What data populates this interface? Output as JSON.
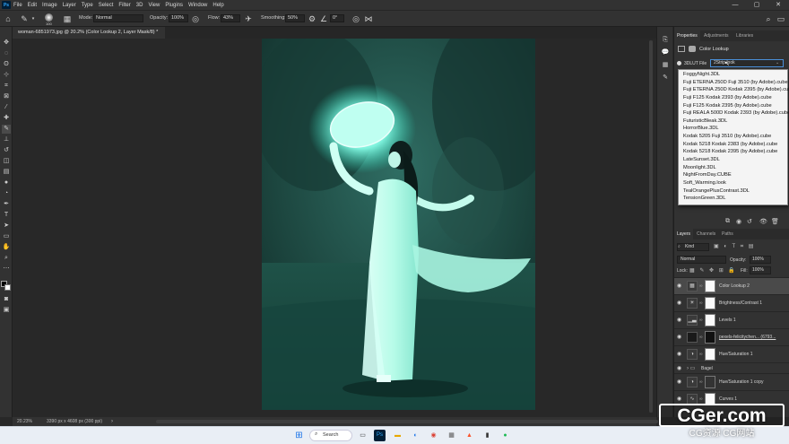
{
  "menubar": {
    "app_icon": "Ps",
    "items": [
      "File",
      "Edit",
      "Image",
      "Layer",
      "Type",
      "Select",
      "Filter",
      "3D",
      "View",
      "Plugins",
      "Window",
      "Help"
    ],
    "window_controls": [
      "—",
      "▢",
      "✕"
    ]
  },
  "options_bar": {
    "brush_size": "100",
    "mode_label": "Mode:",
    "mode_value": "Normal",
    "opacity_label": "Opacity:",
    "opacity_value": "100%",
    "flow_label": "Flow:",
    "flow_value": "43%",
    "smoothing_label": "Smoothing:",
    "smoothing_value": "50%",
    "angle_value": "0°"
  },
  "document": {
    "tab_title": "woman-6851973.jpg @ 20.2% (Color Lookup 2, Layer Mask/8) *",
    "zoom": "20.23%",
    "dimensions": "3390 px x 4608 px (300 ppi)"
  },
  "properties": {
    "tabs": [
      "Properties",
      "Adjustments",
      "Libraries"
    ],
    "panel_title": "Color Lookup",
    "row_label": "3DLUT File",
    "row_value": "2Strip.look"
  },
  "lut_options": [
    "FoggyNight.3DL",
    "Fuji ETERNA 250D Fuji 3510 (by Adobe).cube",
    "Fuji ETERNA 250D Kodak 2395 (by Adobe).cube",
    "Fuji F125 Kodak 2393 (by Adobe).cube",
    "Fuji F125 Kodak 2395 (by Adobe).cube",
    "Fuji REALA 500D Kodak 2393 (by Adobe).cube",
    "FuturisticBleak.3DL",
    "HorrorBlue.3DL",
    "Kodak 5205 Fuji 3510 (by Adobe).cube",
    "Kodak 5218 Kodak 2383 (by Adobe).cube",
    "Kodak 5218 Kodak 2395 (by Adobe).cube",
    "LateSunset.3DL",
    "Moonlight.3DL",
    "NightFromDay.CUBE",
    "Soft_Warming.look",
    "TealOrangePlusContrast.3DL",
    "TensionGreen.3DL"
  ],
  "layers_panel": {
    "tabs": [
      "Layers",
      "Channels",
      "Paths"
    ],
    "filter_kind": "Kind",
    "blend_mode": "Normal",
    "opacity_label": "Opacity:",
    "opacity_value": "100%",
    "lock_label": "Lock:",
    "fill_label": "Fill:",
    "fill_value": "100%",
    "layers": [
      {
        "name": "Color Lookup 2",
        "icon": "grid-icon"
      },
      {
        "name": "Brightness/Contrast 1",
        "icon": "sun-icon"
      },
      {
        "name": "Levels 1",
        "icon": "histogram-icon"
      },
      {
        "name": "pexels-felicitychen... (6793...",
        "icon": "photo-icon"
      },
      {
        "name": "Hue/Saturation 1",
        "icon": "hue-icon"
      },
      {
        "name": "Bagel",
        "icon": "folder-icon"
      },
      {
        "name": "Hue/Saturation 1 copy",
        "icon": "hue-icon"
      },
      {
        "name": "Curves 1",
        "icon": "curves-icon"
      }
    ]
  },
  "taskbar": {
    "search_label": "Search"
  },
  "watermark": {
    "title": "CGer.com",
    "subtitle": "CG资源 CG网站"
  },
  "colors": {
    "accent": "#31a8ff",
    "teal_glow": "#66ffe0",
    "panel_bg": "#323232"
  }
}
